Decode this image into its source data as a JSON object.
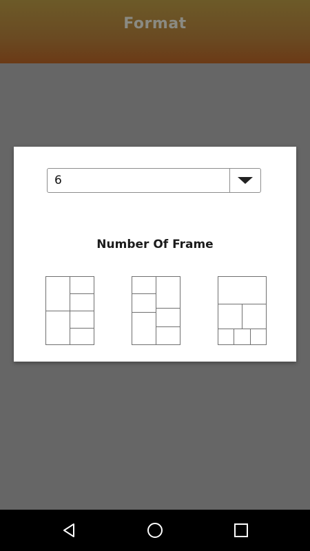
{
  "header": {
    "title": "Format"
  },
  "dialog": {
    "frame_count_select": {
      "selected_value": "6"
    },
    "subtitle": "Number Of Frame",
    "layouts": [
      {
        "name": "layout-option-1"
      },
      {
        "name": "layout-option-2"
      },
      {
        "name": "layout-option-3"
      }
    ]
  },
  "navbar": {
    "icons": [
      "back-icon",
      "home-icon",
      "recents-icon"
    ]
  },
  "colors": {
    "header_gradient_top": "#6c5a28",
    "header_gradient_bottom": "#6b3a16",
    "scrim": "#666666",
    "dialog_bg": "#ffffff",
    "navbar_bg": "#000000"
  }
}
